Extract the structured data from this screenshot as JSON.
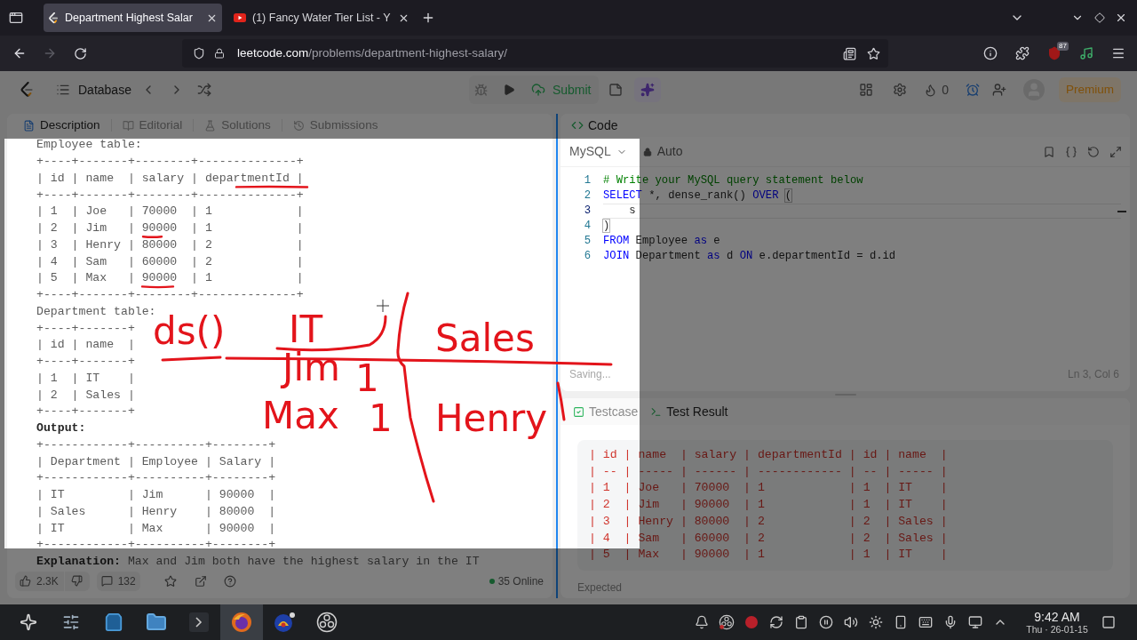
{
  "browser": {
    "tabs": [
      {
        "title": "Department Highest Salar",
        "selected": true,
        "kind": "bracket"
      },
      {
        "title": "(1) Fancy Water Tier List - Y",
        "selected": false,
        "kind": "play"
      }
    ],
    "forward_disabled": true,
    "url": {
      "host": "leetcode.com",
      "path": "/problems/department-highest-salary/"
    },
    "extension_badge": "87"
  },
  "header": {
    "problem_list": "Database",
    "submit": "Submit",
    "streak": "0",
    "premium": "Premium"
  },
  "description_panel": {
    "tabs": [
      {
        "label": "Description",
        "selected": true
      },
      {
        "label": "Editorial",
        "selected": false
      },
      {
        "label": "Solutions",
        "selected": false
      },
      {
        "label": "Submissions",
        "selected": false
      }
    ],
    "blocks": [
      {
        "kind": "caption",
        "text": "Employee table:"
      },
      {
        "kind": "table",
        "lines": [
          "+----+-------+--------+--------------+",
          "| id | name  | salary | departmentId |",
          "+----+-------+--------+--------------+",
          "| 1  | Joe   | 70000  | 1            |",
          "| 2  | Jim   | 90000  | 1            |",
          "| 3  | Henry | 80000  | 2            |",
          "| 4  | Sam   | 60000  | 2            |",
          "| 5  | Max   | 90000  | 1            |",
          "+----+-------+--------+--------------+"
        ]
      },
      {
        "kind": "caption",
        "text": "Department table:"
      },
      {
        "kind": "table",
        "lines": [
          "+----+-------+",
          "| id | name  |",
          "+----+-------+",
          "| 1  | IT    |",
          "| 2  | Sales |",
          "+----+-------+"
        ]
      },
      {
        "kind": "label",
        "text": "Output:"
      },
      {
        "kind": "table",
        "lines": [
          "+------------+----------+--------+",
          "| Department | Employee | Salary |",
          "+------------+----------+--------+",
          "| IT         | Jim      | 90000  |",
          "| Sales      | Henry    | 80000  |",
          "| IT         | Max      | 90000  |",
          "+------------+----------+--------+"
        ]
      },
      {
        "kind": "explanation",
        "text": "**Explanation:** Max and Jim both have the highest salary in the IT"
      }
    ],
    "footer": {
      "likes": "2.3K",
      "comments": "132",
      "online": "35 Online"
    }
  },
  "code_panel": {
    "title": "Code",
    "language": "MySQL",
    "mode": "Auto",
    "lines": [
      {
        "number": "1",
        "active": false,
        "tokens": [
          {
            "kind": "comment",
            "text": "# Write your MySQL query statement below"
          }
        ]
      },
      {
        "number": "2",
        "active": false,
        "tokens": [
          {
            "kind": "keyword",
            "text": "SELECT"
          },
          {
            "kind": "plain",
            "text": " *, dense_rank() "
          },
          {
            "kind": "keyword",
            "text": "OVER "
          },
          {
            "kind": "bracket",
            "text": "("
          }
        ]
      },
      {
        "number": "3",
        "active": true,
        "tokens": [
          {
            "kind": "plain",
            "text": "    s"
          }
        ]
      },
      {
        "number": "4",
        "active": false,
        "tokens": [
          {
            "kind": "bracket",
            "text": ")"
          }
        ]
      },
      {
        "number": "5",
        "active": false,
        "tokens": [
          {
            "kind": "keyword",
            "text": "FROM"
          },
          {
            "kind": "plain",
            "text": " Employee "
          },
          {
            "kind": "keyword",
            "text": "as"
          },
          {
            "kind": "plain",
            "text": " e"
          }
        ]
      },
      {
        "number": "6",
        "active": false,
        "tokens": [
          {
            "kind": "keyword",
            "text": "JOIN"
          },
          {
            "kind": "plain",
            "text": " Department "
          },
          {
            "kind": "keyword",
            "text": "as"
          },
          {
            "kind": "plain",
            "text": " d "
          },
          {
            "kind": "keyword",
            "text": "ON"
          },
          {
            "kind": "plain",
            "text": " e.departmentId = d.id"
          }
        ]
      }
    ],
    "save_status": "Saving...",
    "cursor_position": "Ln 3, Col 6"
  },
  "result_panel": {
    "tabs": [
      {
        "label": "Testcase",
        "selected": false
      },
      {
        "label": "Test Result",
        "selected": true
      }
    ],
    "output_lines": [
      "| id | name  | salary | departmentId | id | name  |",
      "| -- | ----- | ------ | ------------ | -- | ----- |",
      "| 1  | Joe   | 70000  | 1            | 1  | IT    |",
      "| 2  | Jim   | 90000  | 1            | 1  | IT    |",
      "| 3  | Henry | 80000  | 2            | 2  | Sales |",
      "| 4  | Sam   | 60000  | 2            | 2  | Sales |",
      "| 5  | Max   | 90000  | 1            | 1  | IT    |"
    ],
    "expected_label": "Expected"
  },
  "annotations": {
    "notes": [
      {
        "text": "ds()"
      },
      {
        "text": "IT"
      },
      {
        "text": "Jim"
      },
      {
        "text": "1"
      },
      {
        "text": "Max"
      },
      {
        "text": "1"
      },
      {
        "text": "Sales"
      },
      {
        "text": "Henry"
      }
    ]
  },
  "taskbar": {
    "apps": [
      {
        "kind": "launcher",
        "active": false
      },
      {
        "kind": "sliders",
        "active": false
      },
      {
        "kind": "store",
        "active": false
      },
      {
        "kind": "files",
        "active": false
      },
      {
        "kind": "terminal",
        "active": false
      },
      {
        "kind": "browser",
        "active": true
      },
      {
        "kind": "game",
        "active": false
      },
      {
        "kind": "recorder",
        "active": false
      }
    ],
    "time": "9:42 AM",
    "date": "Thu · 26-01-15"
  }
}
